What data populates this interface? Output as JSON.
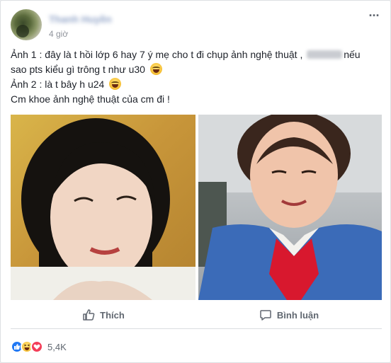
{
  "post": {
    "author": "Thanh Huyền",
    "time": "4 giờ",
    "text": {
      "line1_a": "Ảnh 1 : đây là t hồi lớp 6 hay 7 ý mẹ cho t đi chụp ảnh nghệ thuật , ",
      "line1_b": "nếu",
      "line2": "sao pts kiểu gì trông t như u30",
      "line3": "Ảnh 2 : là t bây h u24",
      "line4": "Cm khoe ảnh nghệ thuật của cm đi !"
    }
  },
  "actions": {
    "like_label": "Thích",
    "comment_label": "Bình luận"
  },
  "reactions": {
    "count": "5,4K",
    "icons": [
      "like-icon",
      "haha-icon",
      "love-icon"
    ]
  },
  "icons": {
    "more": "more-options-icon",
    "like": "thumbs-up-icon",
    "comment": "comment-bubble-icon",
    "emoji": "laughing-emoji-icon"
  },
  "colors": {
    "author": "#365899",
    "muted": "#90949c",
    "like_blue": "#2078f4",
    "love_red": "#f33e58"
  }
}
